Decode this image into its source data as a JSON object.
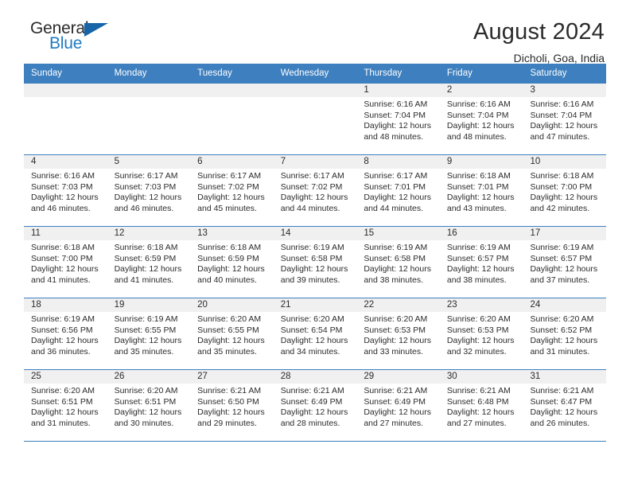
{
  "brand": {
    "name_top": "General",
    "name_bottom": "Blue",
    "mark": "triangle-logo",
    "accent_color": "#1f7bc1"
  },
  "header": {
    "title": "August 2024",
    "location": "Dicholi, Goa, India"
  },
  "calendar": {
    "header_bg": "#3d7fbf",
    "daynum_bg": "#f0f0f0",
    "weekdays": [
      "Sunday",
      "Monday",
      "Tuesday",
      "Wednesday",
      "Thursday",
      "Friday",
      "Saturday"
    ],
    "weeks": [
      [
        {
          "day": "",
          "sunrise": "",
          "sunset": "",
          "daylight1": "",
          "daylight2": ""
        },
        {
          "day": "",
          "sunrise": "",
          "sunset": "",
          "daylight1": "",
          "daylight2": ""
        },
        {
          "day": "",
          "sunrise": "",
          "sunset": "",
          "daylight1": "",
          "daylight2": ""
        },
        {
          "day": "",
          "sunrise": "",
          "sunset": "",
          "daylight1": "",
          "daylight2": ""
        },
        {
          "day": "1",
          "sunrise": "Sunrise: 6:16 AM",
          "sunset": "Sunset: 7:04 PM",
          "daylight1": "Daylight: 12 hours",
          "daylight2": "and 48 minutes."
        },
        {
          "day": "2",
          "sunrise": "Sunrise: 6:16 AM",
          "sunset": "Sunset: 7:04 PM",
          "daylight1": "Daylight: 12 hours",
          "daylight2": "and 48 minutes."
        },
        {
          "day": "3",
          "sunrise": "Sunrise: 6:16 AM",
          "sunset": "Sunset: 7:04 PM",
          "daylight1": "Daylight: 12 hours",
          "daylight2": "and 47 minutes."
        }
      ],
      [
        {
          "day": "4",
          "sunrise": "Sunrise: 6:16 AM",
          "sunset": "Sunset: 7:03 PM",
          "daylight1": "Daylight: 12 hours",
          "daylight2": "and 46 minutes."
        },
        {
          "day": "5",
          "sunrise": "Sunrise: 6:17 AM",
          "sunset": "Sunset: 7:03 PM",
          "daylight1": "Daylight: 12 hours",
          "daylight2": "and 46 minutes."
        },
        {
          "day": "6",
          "sunrise": "Sunrise: 6:17 AM",
          "sunset": "Sunset: 7:02 PM",
          "daylight1": "Daylight: 12 hours",
          "daylight2": "and 45 minutes."
        },
        {
          "day": "7",
          "sunrise": "Sunrise: 6:17 AM",
          "sunset": "Sunset: 7:02 PM",
          "daylight1": "Daylight: 12 hours",
          "daylight2": "and 44 minutes."
        },
        {
          "day": "8",
          "sunrise": "Sunrise: 6:17 AM",
          "sunset": "Sunset: 7:01 PM",
          "daylight1": "Daylight: 12 hours",
          "daylight2": "and 44 minutes."
        },
        {
          "day": "9",
          "sunrise": "Sunrise: 6:18 AM",
          "sunset": "Sunset: 7:01 PM",
          "daylight1": "Daylight: 12 hours",
          "daylight2": "and 43 minutes."
        },
        {
          "day": "10",
          "sunrise": "Sunrise: 6:18 AM",
          "sunset": "Sunset: 7:00 PM",
          "daylight1": "Daylight: 12 hours",
          "daylight2": "and 42 minutes."
        }
      ],
      [
        {
          "day": "11",
          "sunrise": "Sunrise: 6:18 AM",
          "sunset": "Sunset: 7:00 PM",
          "daylight1": "Daylight: 12 hours",
          "daylight2": "and 41 minutes."
        },
        {
          "day": "12",
          "sunrise": "Sunrise: 6:18 AM",
          "sunset": "Sunset: 6:59 PM",
          "daylight1": "Daylight: 12 hours",
          "daylight2": "and 41 minutes."
        },
        {
          "day": "13",
          "sunrise": "Sunrise: 6:18 AM",
          "sunset": "Sunset: 6:59 PM",
          "daylight1": "Daylight: 12 hours",
          "daylight2": "and 40 minutes."
        },
        {
          "day": "14",
          "sunrise": "Sunrise: 6:19 AM",
          "sunset": "Sunset: 6:58 PM",
          "daylight1": "Daylight: 12 hours",
          "daylight2": "and 39 minutes."
        },
        {
          "day": "15",
          "sunrise": "Sunrise: 6:19 AM",
          "sunset": "Sunset: 6:58 PM",
          "daylight1": "Daylight: 12 hours",
          "daylight2": "and 38 minutes."
        },
        {
          "day": "16",
          "sunrise": "Sunrise: 6:19 AM",
          "sunset": "Sunset: 6:57 PM",
          "daylight1": "Daylight: 12 hours",
          "daylight2": "and 38 minutes."
        },
        {
          "day": "17",
          "sunrise": "Sunrise: 6:19 AM",
          "sunset": "Sunset: 6:57 PM",
          "daylight1": "Daylight: 12 hours",
          "daylight2": "and 37 minutes."
        }
      ],
      [
        {
          "day": "18",
          "sunrise": "Sunrise: 6:19 AM",
          "sunset": "Sunset: 6:56 PM",
          "daylight1": "Daylight: 12 hours",
          "daylight2": "and 36 minutes."
        },
        {
          "day": "19",
          "sunrise": "Sunrise: 6:19 AM",
          "sunset": "Sunset: 6:55 PM",
          "daylight1": "Daylight: 12 hours",
          "daylight2": "and 35 minutes."
        },
        {
          "day": "20",
          "sunrise": "Sunrise: 6:20 AM",
          "sunset": "Sunset: 6:55 PM",
          "daylight1": "Daylight: 12 hours",
          "daylight2": "and 35 minutes."
        },
        {
          "day": "21",
          "sunrise": "Sunrise: 6:20 AM",
          "sunset": "Sunset: 6:54 PM",
          "daylight1": "Daylight: 12 hours",
          "daylight2": "and 34 minutes."
        },
        {
          "day": "22",
          "sunrise": "Sunrise: 6:20 AM",
          "sunset": "Sunset: 6:53 PM",
          "daylight1": "Daylight: 12 hours",
          "daylight2": "and 33 minutes."
        },
        {
          "day": "23",
          "sunrise": "Sunrise: 6:20 AM",
          "sunset": "Sunset: 6:53 PM",
          "daylight1": "Daylight: 12 hours",
          "daylight2": "and 32 minutes."
        },
        {
          "day": "24",
          "sunrise": "Sunrise: 6:20 AM",
          "sunset": "Sunset: 6:52 PM",
          "daylight1": "Daylight: 12 hours",
          "daylight2": "and 31 minutes."
        }
      ],
      [
        {
          "day": "25",
          "sunrise": "Sunrise: 6:20 AM",
          "sunset": "Sunset: 6:51 PM",
          "daylight1": "Daylight: 12 hours",
          "daylight2": "and 31 minutes."
        },
        {
          "day": "26",
          "sunrise": "Sunrise: 6:20 AM",
          "sunset": "Sunset: 6:51 PM",
          "daylight1": "Daylight: 12 hours",
          "daylight2": "and 30 minutes."
        },
        {
          "day": "27",
          "sunrise": "Sunrise: 6:21 AM",
          "sunset": "Sunset: 6:50 PM",
          "daylight1": "Daylight: 12 hours",
          "daylight2": "and 29 minutes."
        },
        {
          "day": "28",
          "sunrise": "Sunrise: 6:21 AM",
          "sunset": "Sunset: 6:49 PM",
          "daylight1": "Daylight: 12 hours",
          "daylight2": "and 28 minutes."
        },
        {
          "day": "29",
          "sunrise": "Sunrise: 6:21 AM",
          "sunset": "Sunset: 6:49 PM",
          "daylight1": "Daylight: 12 hours",
          "daylight2": "and 27 minutes."
        },
        {
          "day": "30",
          "sunrise": "Sunrise: 6:21 AM",
          "sunset": "Sunset: 6:48 PM",
          "daylight1": "Daylight: 12 hours",
          "daylight2": "and 27 minutes."
        },
        {
          "day": "31",
          "sunrise": "Sunrise: 6:21 AM",
          "sunset": "Sunset: 6:47 PM",
          "daylight1": "Daylight: 12 hours",
          "daylight2": "and 26 minutes."
        }
      ]
    ]
  }
}
